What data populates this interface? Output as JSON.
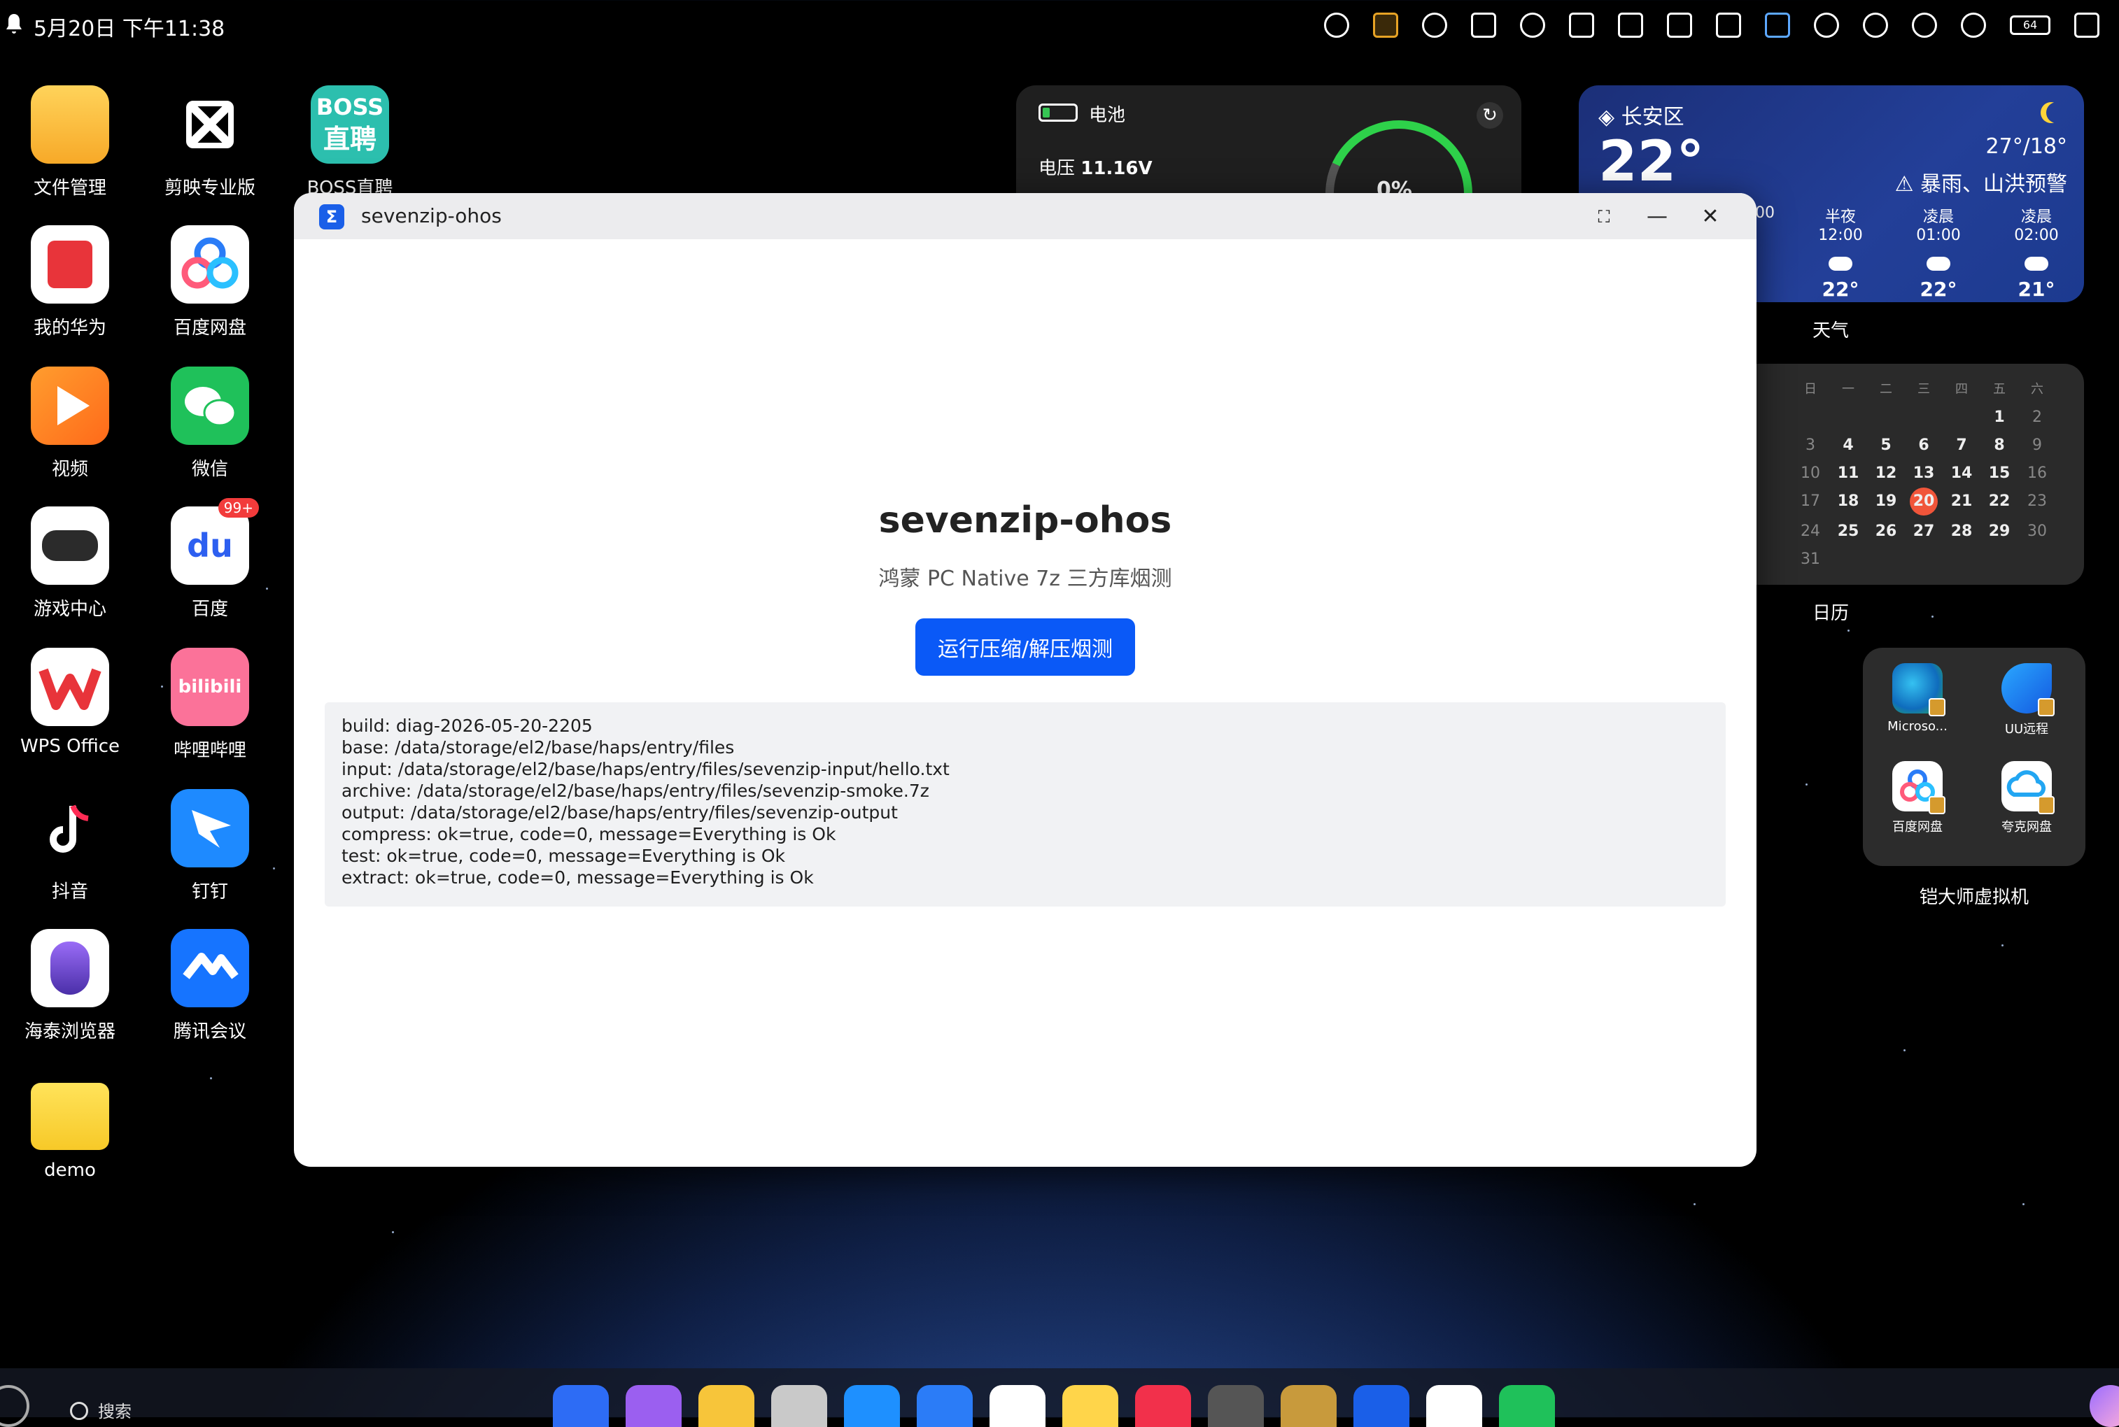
{
  "status_bar": {
    "time": "5月20日 下午11:38",
    "battery_level": "64"
  },
  "desktop_apps": [
    {
      "label": "文件管理"
    },
    {
      "label": "剪映专业版"
    },
    {
      "label": "BOSS直聘",
      "icon_text_1": "BOSS",
      "icon_text_2": "直聘"
    },
    {
      "label": "我的华为"
    },
    {
      "label": "百度网盘"
    },
    {
      "label": "视频"
    },
    {
      "label": "微信"
    },
    {
      "label": "游戏中心"
    },
    {
      "label": "百度",
      "badge": "99+",
      "icon_text": "du"
    },
    {
      "label": "WPS Office"
    },
    {
      "label": "哔哩哔哩",
      "icon_text": "bilibili"
    },
    {
      "label": "抖音"
    },
    {
      "label": "钉钉"
    },
    {
      "label": "海泰浏览器"
    },
    {
      "label": "腾讯会议"
    },
    {
      "label": "demo"
    }
  ],
  "battery_widget": {
    "title": "电池",
    "voltage_label": "电压",
    "voltage_value": "11.16V",
    "refresh_icon": "↻",
    "percent": "0%"
  },
  "weather": {
    "location": "长安区",
    "temp": "22°",
    "range": "27°/18°",
    "warning": "暴雨、山洪预警",
    "hours": [
      {
        "time": "半夜12:00",
        "temp": "22°"
      },
      {
        "time": "凌晨01:00",
        "temp": "22°"
      },
      {
        "time": "凌晨02:00",
        "temp": "21°"
      }
    ],
    "partial_hour": "00",
    "caption": "天气"
  },
  "calendar": {
    "weekdays": [
      "日",
      "一",
      "二",
      "三",
      "四",
      "五",
      "六"
    ],
    "today": "20",
    "caption": "日历"
  },
  "vm_widget": {
    "apps": [
      {
        "label": "Microso..."
      },
      {
        "label": "UU远程"
      },
      {
        "label": "百度网盘"
      },
      {
        "label": "夸克网盘"
      }
    ],
    "caption": "铠大师虚拟机"
  },
  "window": {
    "title": "sevenzip-ohos",
    "icon_glyph": "Σ",
    "maximize_icon": "⛶",
    "minimize_icon": "—",
    "close_icon": "✕",
    "app_title": "sevenzip-ohos",
    "subtitle": "鸿蒙 PC Native 7z 三方库烟测",
    "run_button": "运行压缩/解压烟测",
    "log_lines": [
      "build: diag-2026-05-20-2205",
      "base: /data/storage/el2/base/haps/entry/files",
      "input: /data/storage/el2/base/haps/entry/files/sevenzip-input/hello.txt",
      "archive: /data/storage/el2/base/haps/entry/files/sevenzip-smoke.7z",
      "output: /data/storage/el2/base/haps/entry/files/sevenzip-output",
      "compress: ok=true, code=0, message=Everything is Ok",
      "test: ok=true, code=0, message=Everything is Ok",
      "extract: ok=true, code=0, message=Everything is Ok"
    ]
  },
  "dock": {
    "search_label": "搜索"
  },
  "colors": {
    "accent": "#0a59f7",
    "today_circle": "#f0553a",
    "battery_green": "#2ed14a"
  }
}
